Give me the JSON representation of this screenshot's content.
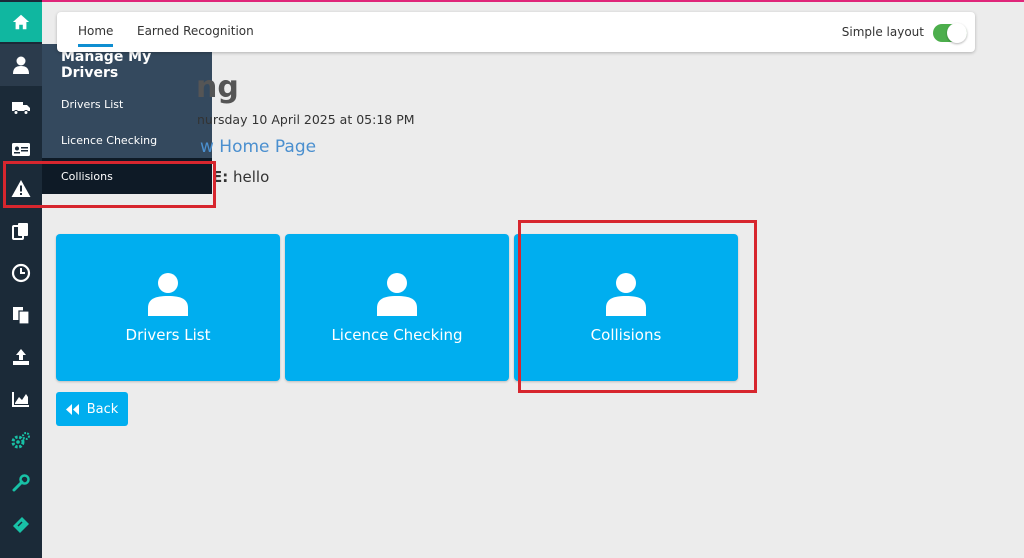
{
  "sidebar": {
    "icons": [
      "home-icon",
      "user-icon",
      "truck-icon",
      "id-card-icon",
      "warning-icon",
      "documents-icon",
      "clock-icon",
      "files-icon",
      "upload-icon",
      "chart-icon",
      "gears-icon",
      "wrench-icon",
      "ticket-icon"
    ]
  },
  "flyout": {
    "title": "Manage My Drivers",
    "items": [
      "Drivers List",
      "Licence Checking",
      "Collisions"
    ]
  },
  "topbar": {
    "tabs": [
      "Home",
      "Earned Recognition"
    ],
    "simple_layout_label": "Simple layout",
    "simple_layout_on": true
  },
  "page": {
    "title_fragment": "ng",
    "timestamp_fragment": "nursday 10 April 2025 at 05:18 PM",
    "home_link_fragment": "w Home Page",
    "note_label_fragment": "E:",
    "note_value": "hello"
  },
  "tiles": [
    {
      "label": "Drivers List"
    },
    {
      "label": "Licence Checking"
    },
    {
      "label": "Collisions"
    }
  ],
  "back_button": {
    "label": "Back"
  },
  "colors": {
    "accent": "#00aeef",
    "sidebar": "#1b2a38",
    "home_tab": "#10b7a0",
    "highlight": "#d7262e",
    "toggle_on": "#4cae4c"
  }
}
